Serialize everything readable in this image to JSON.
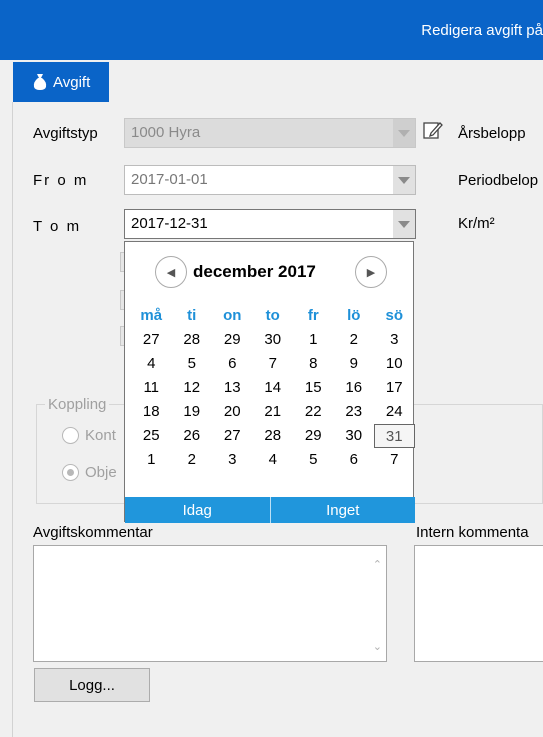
{
  "window": {
    "title": "Redigera avgift på"
  },
  "tab": {
    "label": "Avgift"
  },
  "form": {
    "avgiftstyp_label": "Avgiftstyp",
    "avgiftstyp_value": "1000   Hyra",
    "from_label": "Fr o m",
    "from_value": "2017-01-01",
    "tom_label": "T o m",
    "tom_value": "2017-12-31",
    "arsbelopp_label": "Årsbelopp",
    "periodbelopp_label": "Periodbelop",
    "krm2_label": "Kr/m²"
  },
  "koppling": {
    "legend": "Koppling",
    "radio1": "Kont",
    "radio2": "Obje"
  },
  "comments": {
    "avgift_label": "Avgiftskommentar",
    "intern_label": "Intern kommenta"
  },
  "buttons": {
    "logg": "Logg..."
  },
  "calendar": {
    "month_title": "december 2017",
    "weekdays": [
      "må",
      "ti",
      "on",
      "to",
      "fr",
      "lö",
      "sö"
    ],
    "weeks": [
      [
        "27",
        "28",
        "29",
        "30",
        "1",
        "2",
        "3"
      ],
      [
        "4",
        "5",
        "6",
        "7",
        "8",
        "9",
        "10"
      ],
      [
        "11",
        "12",
        "13",
        "14",
        "15",
        "16",
        "17"
      ],
      [
        "18",
        "19",
        "20",
        "21",
        "22",
        "23",
        "24"
      ],
      [
        "25",
        "26",
        "27",
        "28",
        "29",
        "30",
        "31"
      ],
      [
        "1",
        "2",
        "3",
        "4",
        "5",
        "6",
        "7"
      ]
    ],
    "selected": "31",
    "today_label": "Idag",
    "none_label": "Inget"
  },
  "colors": {
    "accent": "#0a64c8",
    "calendar_accent": "#2096dc"
  }
}
